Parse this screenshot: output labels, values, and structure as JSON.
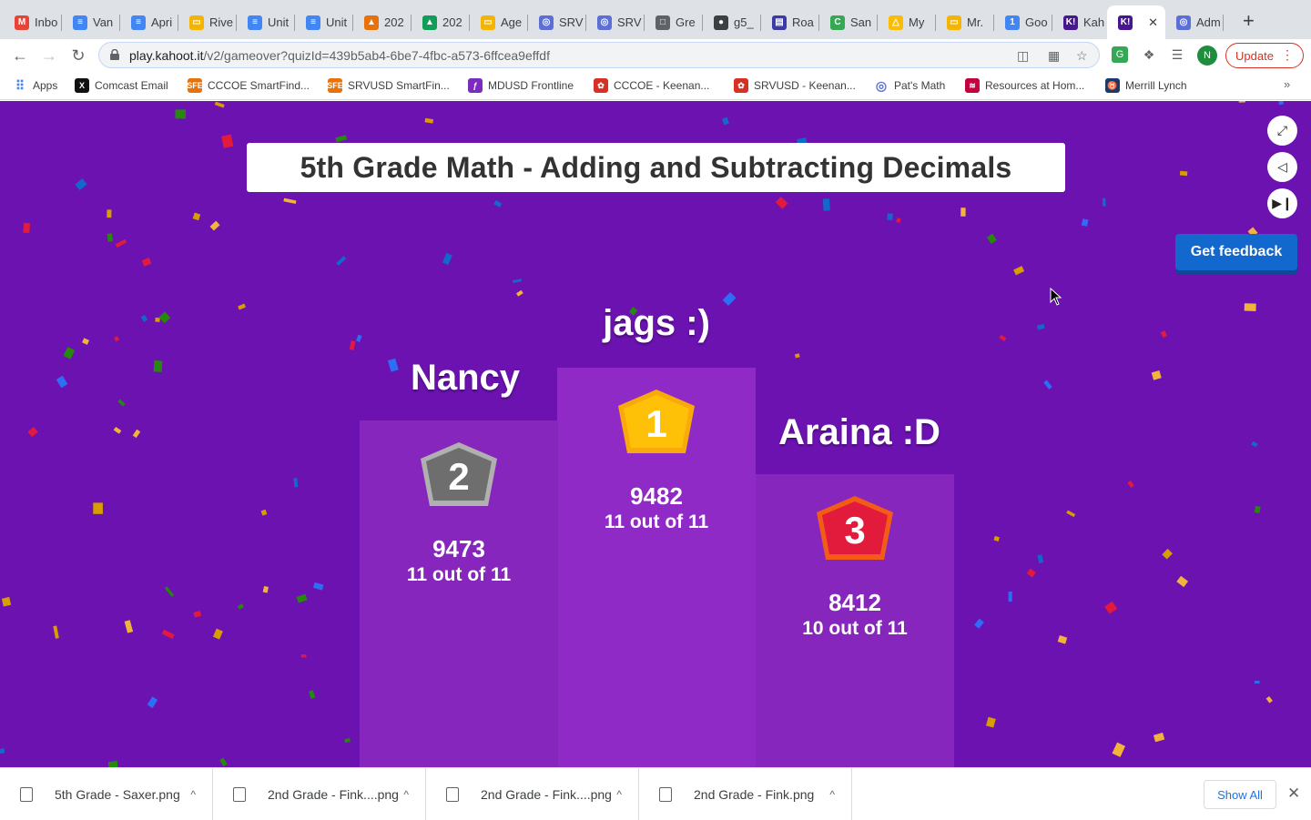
{
  "browser": {
    "tabs": [
      {
        "label": "Inbo",
        "icon": "gmail-icon",
        "color": "#ea4335"
      },
      {
        "label": "Van",
        "icon": "docs-icon",
        "color": "#4285f4"
      },
      {
        "label": "Apri",
        "icon": "docs-icon",
        "color": "#4285f4"
      },
      {
        "label": "Rive",
        "icon": "slides-icon",
        "color": "#f4b400"
      },
      {
        "label": "Unit",
        "icon": "docs-icon",
        "color": "#4285f4"
      },
      {
        "label": "Unit",
        "icon": "docs-icon",
        "color": "#4285f4"
      },
      {
        "label": "202",
        "icon": "contacts-icon",
        "color": "#e8710a"
      },
      {
        "label": "202",
        "icon": "classroom-icon",
        "color": "#0f9d58"
      },
      {
        "label": "Age",
        "icon": "slides-icon",
        "color": "#f4b400"
      },
      {
        "label": "SRV",
        "icon": "globe-icon",
        "color": "#5b6fd6"
      },
      {
        "label": "SRV",
        "icon": "globe-icon",
        "color": "#5b6fd6"
      },
      {
        "label": "Gre",
        "icon": "page-icon",
        "color": "#5f6368"
      },
      {
        "label": "g5_",
        "icon": "world-icon",
        "color": "#3c4043"
      },
      {
        "label": "Roa",
        "icon": "forms-icon",
        "color": "#3b3ba8"
      },
      {
        "label": "San",
        "icon": "c-icon",
        "color": "#34a853"
      },
      {
        "label": "My",
        "icon": "drive-icon",
        "color": "#fbbc04"
      },
      {
        "label": "Mr.",
        "icon": "slides-icon",
        "color": "#f4b400"
      },
      {
        "label": "Goo",
        "icon": "calendar-icon",
        "color": "#4285f4"
      },
      {
        "label": "Kah",
        "icon": "kahoot-icon",
        "color": "#46178f"
      },
      {
        "label": "",
        "icon": "kahoot-icon",
        "color": "#46178f"
      },
      {
        "label": "Adm",
        "icon": "globe-icon",
        "color": "#5b6fd6"
      }
    ],
    "new_tab": "+",
    "url_host": "play.kahoot.it",
    "url_path": "/v2/gameover?quizId=439b5ab4-6be7-4fbc-a573-6ffcea9effdf",
    "avatar_letter": "N",
    "update_label": "Update",
    "bookmarks": [
      {
        "label": "Apps",
        "icon": "apps-grid-icon",
        "color": "#4285f4"
      },
      {
        "label": "Comcast Email",
        "icon": "x-logo-icon",
        "color": "#111111"
      },
      {
        "label": "CCCOE SmartFind...",
        "icon": "sfe-icon",
        "color": "#e8710a"
      },
      {
        "label": "SRVUSD SmartFin...",
        "icon": "sfe-icon",
        "color": "#e8710a"
      },
      {
        "label": "MDUSD Frontline",
        "icon": "frontline-icon",
        "color": "#7b2cbf"
      },
      {
        "label": "CCCOE - Keenan...",
        "icon": "keenan-icon",
        "color": "#d93025"
      },
      {
        "label": "SRVUSD - Keenan...",
        "icon": "keenan-icon",
        "color": "#d93025"
      },
      {
        "label": "Pat's Math",
        "icon": "globe-icon",
        "color": "#5b6fd6"
      },
      {
        "label": "Resources at Hom...",
        "icon": "boa-icon",
        "color": "#c5003e"
      },
      {
        "label": "Merrill Lynch",
        "icon": "bull-icon",
        "color": "#1a3a6b"
      }
    ],
    "bookmarks_more": "»"
  },
  "game": {
    "title": "5th Grade Math - Adding and Subtracting Decimals",
    "feedback_label": "Get feedback",
    "background": "#6b12b0",
    "podium_color": "#8f2ac7",
    "podium": {
      "first": {
        "name": "jags :)",
        "rank": "1",
        "score": "9482",
        "correct": "11 out of 11"
      },
      "second": {
        "name": "Nancy",
        "rank": "2",
        "score": "9473",
        "correct": "11 out of 11"
      },
      "third": {
        "name": "Araina :D",
        "rank": "3",
        "score": "8412",
        "correct": "10 out of 11"
      }
    }
  },
  "downloads": {
    "items": [
      {
        "name": "5th Grade - Saxer.png"
      },
      {
        "name": "2nd Grade - Fink....png"
      },
      {
        "name": "2nd Grade - Fink....png"
      },
      {
        "name": "2nd Grade - Fink.png"
      }
    ],
    "show_all": "Show All"
  }
}
